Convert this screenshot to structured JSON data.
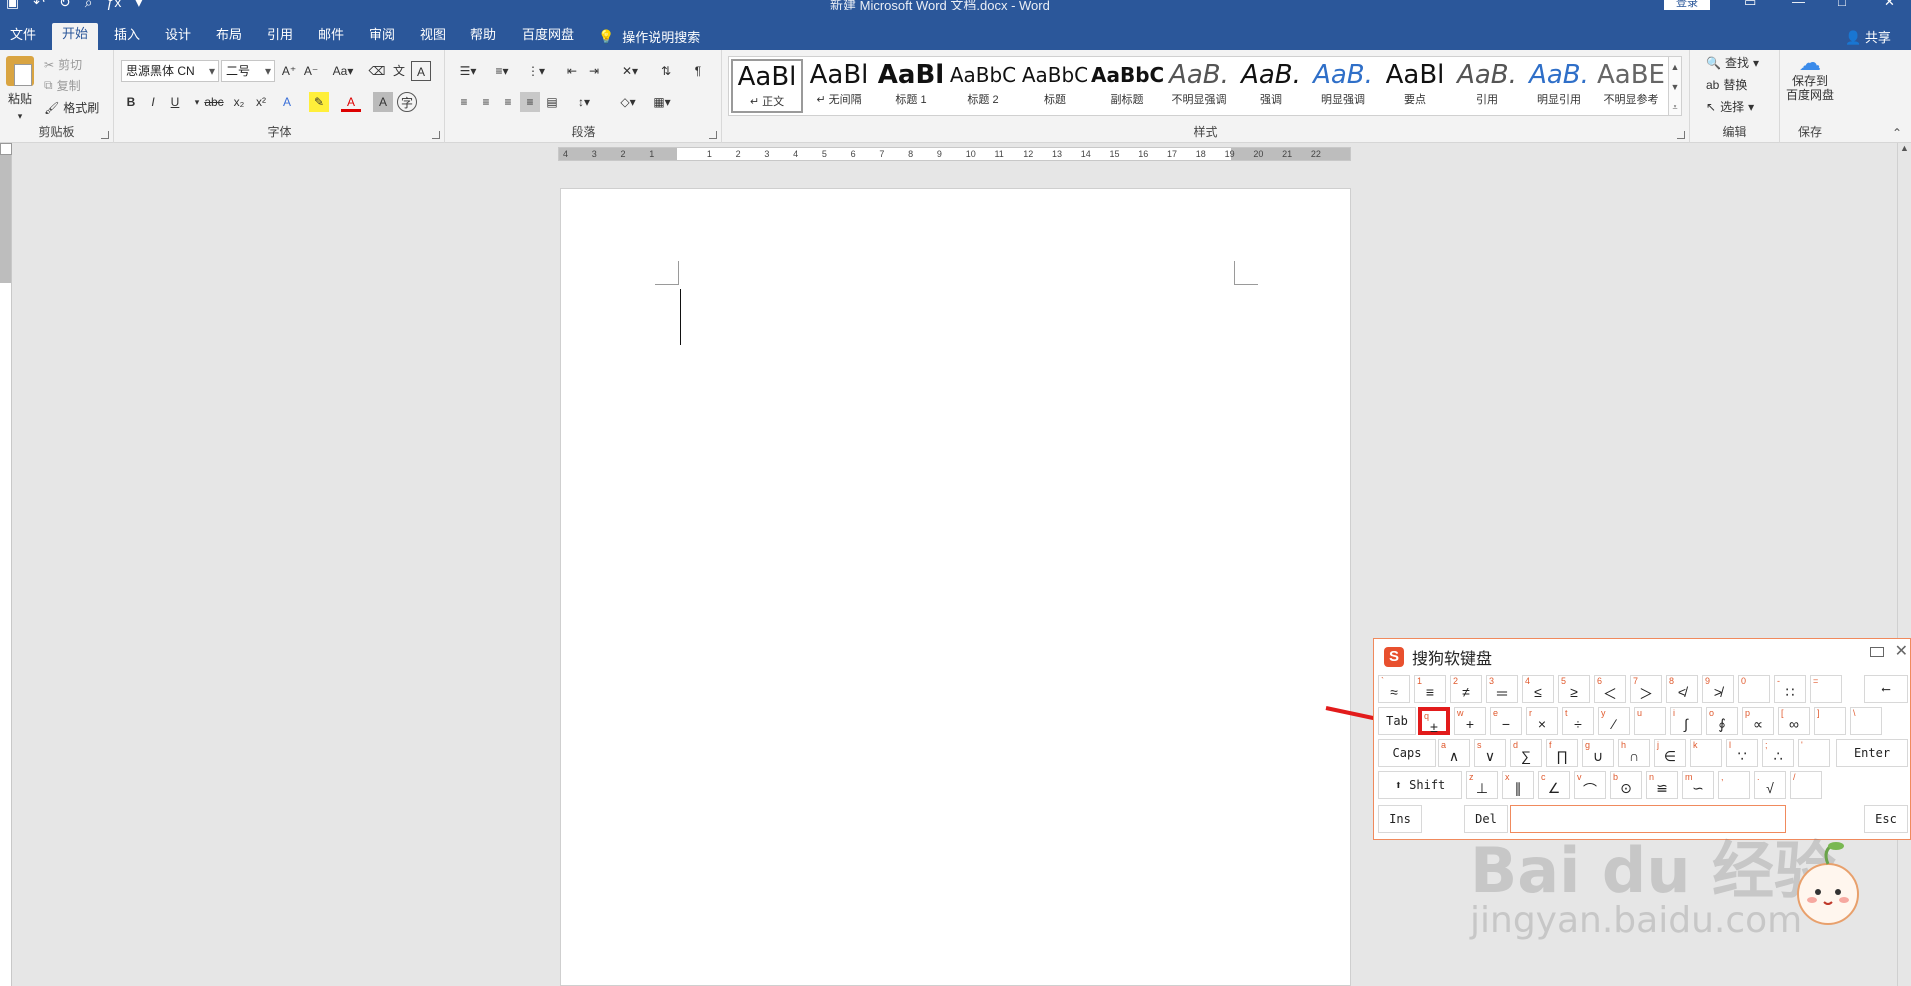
{
  "title_bar": {
    "title": "新建 Microsoft Word 文档.docx - Word",
    "login_label": "登录"
  },
  "tabs": [
    "文件",
    "开始",
    "插入",
    "设计",
    "布局",
    "引用",
    "邮件",
    "审阅",
    "视图",
    "帮助",
    "百度网盘"
  ],
  "active_tab": "开始",
  "tell_me": "操作说明搜索",
  "share": "共享",
  "clipboard": {
    "paste": "粘贴",
    "cut": "剪切",
    "copy": "复制",
    "format_painter": "格式刷",
    "label": "剪贴板"
  },
  "font": {
    "font_name": "思源黑体 CN",
    "font_size": "二号",
    "label": "字体"
  },
  "paragraph": {
    "label": "段落"
  },
  "styles": {
    "label": "样式",
    "items": [
      {
        "sample": "AaBl",
        "name": "↵ 正文"
      },
      {
        "sample": "AaBl",
        "name": "↵ 无间隔"
      },
      {
        "sample": "AaBl",
        "name": "标题 1"
      },
      {
        "sample": "AaBbC",
        "name": "标题 2"
      },
      {
        "sample": "AaBbC",
        "name": "标题"
      },
      {
        "sample": "AaBbC",
        "name": "副标题"
      },
      {
        "sample": "AaB.",
        "name": "不明显强调"
      },
      {
        "sample": "AaB.",
        "name": "强调"
      },
      {
        "sample": "AaB.",
        "name": "明显强调"
      },
      {
        "sample": "AaBl",
        "name": "要点"
      },
      {
        "sample": "AaB.",
        "name": "引用"
      },
      {
        "sample": "AaB.",
        "name": "明显引用"
      },
      {
        "sample": "AaBE",
        "name": "不明显参考"
      }
    ]
  },
  "editing": {
    "find": "查找",
    "replace": "替换",
    "select": "选择",
    "label": "编辑"
  },
  "save": {
    "button": "保存到\n百度网盘",
    "label": "保存"
  },
  "ruler": {
    "marks": [
      "4",
      "3",
      "2",
      "1",
      "",
      "1",
      "2",
      "3",
      "4",
      "5",
      "6",
      "7",
      "8",
      "9",
      "10",
      "11",
      "12",
      "13",
      "14",
      "15",
      "16",
      "17",
      "18",
      "19",
      "20",
      "21",
      "22"
    ]
  },
  "keyboard": {
    "title": "搜狗软键盘",
    "rows": [
      [
        [
          "`",
          "≈"
        ],
        [
          "1",
          "≡"
        ],
        [
          "2",
          "≠"
        ],
        [
          "3",
          "＝"
        ],
        [
          "4",
          "≤"
        ],
        [
          "5",
          "≥"
        ],
        [
          "6",
          "＜"
        ],
        [
          "7",
          "＞"
        ],
        [
          "8",
          "≮"
        ],
        [
          "9",
          "≯"
        ],
        [
          "0",
          ""
        ],
        [
          "-",
          "∷"
        ],
        [
          "=",
          ""
        ]
      ],
      [
        [
          "q",
          "±"
        ],
        [
          "w",
          "+"
        ],
        [
          "e",
          "−"
        ],
        [
          "r",
          "×"
        ],
        [
          "t",
          "÷"
        ],
        [
          "y",
          "∕"
        ],
        [
          "u",
          ""
        ],
        [
          "i",
          "∫"
        ],
        [
          "o",
          "∮"
        ],
        [
          "p",
          "∝"
        ],
        [
          "[",
          "∞"
        ],
        [
          "]",
          ""
        ],
        [
          "\\",
          ""
        ]
      ],
      [
        [
          "a",
          "∧"
        ],
        [
          "s",
          "∨"
        ],
        [
          "d",
          "∑"
        ],
        [
          "f",
          "∏"
        ],
        [
          "g",
          "∪"
        ],
        [
          "h",
          "∩"
        ],
        [
          "j",
          "∈"
        ],
        [
          "k",
          ""
        ],
        [
          "l",
          "∵"
        ],
        [
          ";",
          "∴"
        ],
        [
          "'",
          ""
        ]
      ],
      [
        [
          "z",
          "⊥"
        ],
        [
          "x",
          "∥"
        ],
        [
          "c",
          "∠"
        ],
        [
          "v",
          "⌒"
        ],
        [
          "b",
          "⊙"
        ],
        [
          "n",
          "≌"
        ],
        [
          "m",
          "∽"
        ],
        [
          ",",
          ""
        ],
        [
          ".",
          "√"
        ],
        [
          "/",
          ""
        ]
      ]
    ],
    "keys": {
      "backspace": "⟵",
      "tab": "Tab",
      "caps": "Caps",
      "enter": "Enter",
      "shift": "⬆ Shift",
      "ins": "Ins",
      "del": "Del",
      "esc": "Esc"
    },
    "highlighted_key": "q"
  },
  "watermark": {
    "brand": "Bai du 经验",
    "url": "jingyan.baidu.com"
  },
  "colors": {
    "ribbon_blue": "#2b579a",
    "highlight_red": "#e21b1b",
    "keyboard_orange": "#f08a5d"
  }
}
